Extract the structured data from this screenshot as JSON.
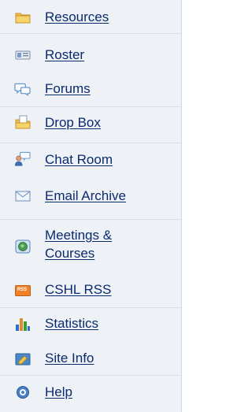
{
  "sidebar": {
    "items": [
      {
        "label": "Resources",
        "icon": "folder-icon"
      },
      {
        "label": "Roster",
        "icon": "roster-card-icon"
      },
      {
        "label": "Forums",
        "icon": "speech-bubbles-icon"
      },
      {
        "label": "Drop Box",
        "icon": "dropbox-folder-icon"
      },
      {
        "label": "Chat Room",
        "icon": "chat-person-icon"
      },
      {
        "label": "Email Archive",
        "icon": "envelope-icon"
      },
      {
        "label": "Meetings &",
        "label2": "Courses",
        "icon": "globe-icon"
      },
      {
        "label": "CSHL RSS",
        "icon": "rss-icon",
        "badge": "RSS"
      },
      {
        "label": "Statistics",
        "icon": "bar-chart-icon"
      },
      {
        "label": "Site Info",
        "icon": "site-info-icon"
      },
      {
        "label": "Help",
        "icon": "help-icon"
      }
    ]
  }
}
